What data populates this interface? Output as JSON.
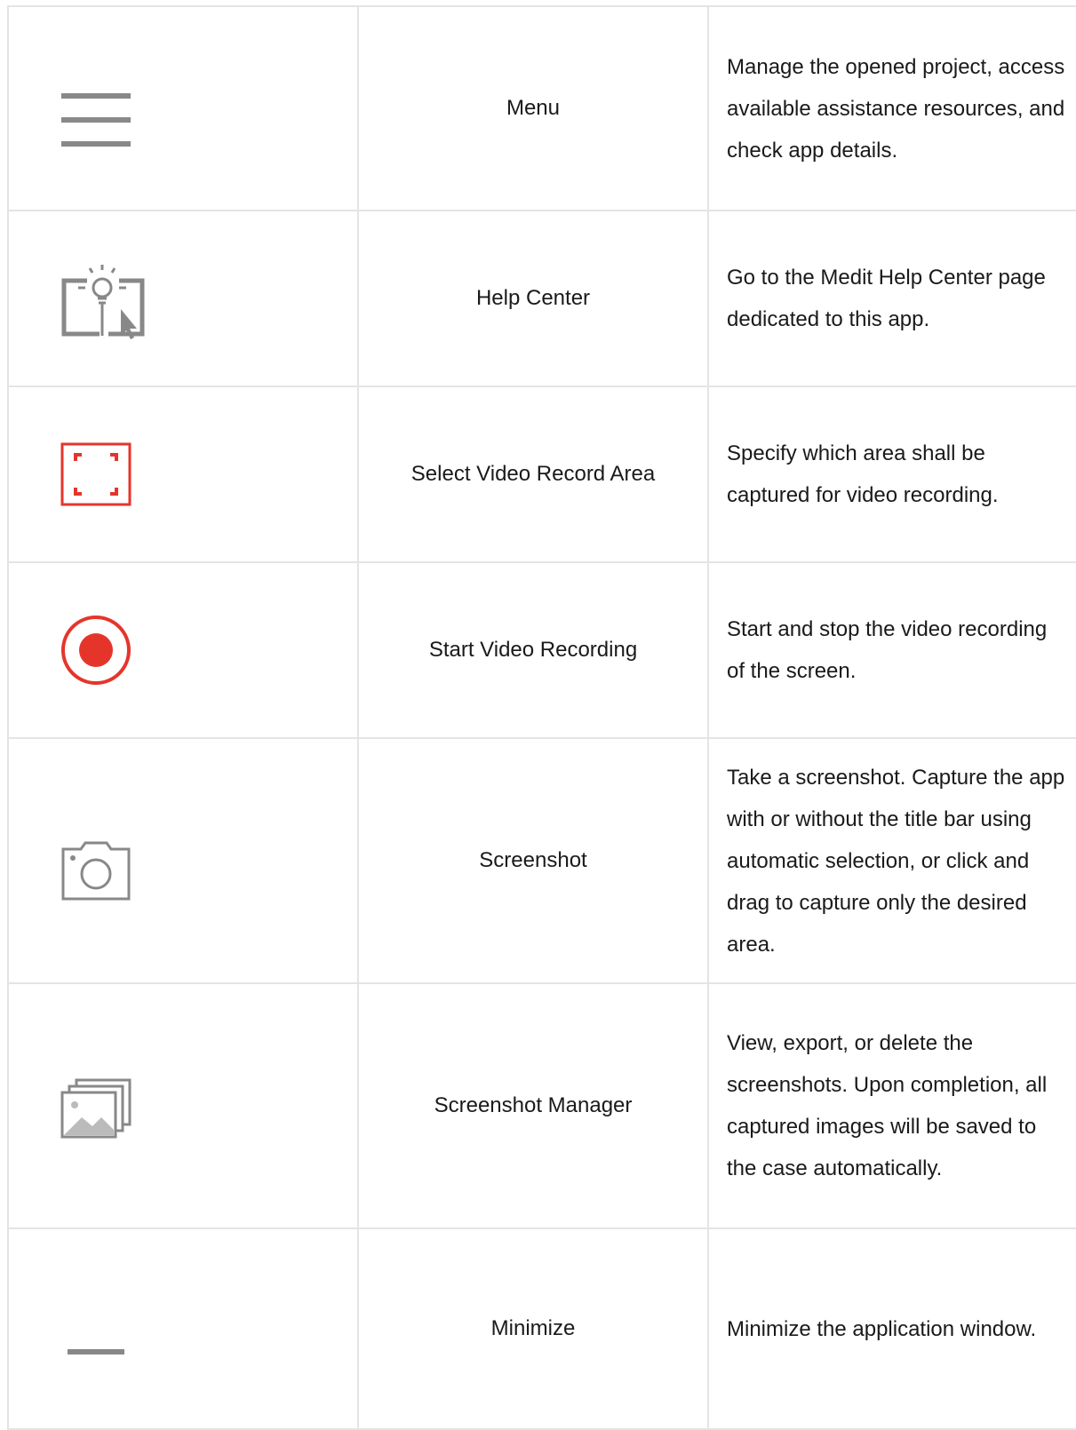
{
  "rows": [
    {
      "icon": "menu-icon",
      "name": "Menu",
      "description": "Manage the opened project, access available assistance resources, and check app details."
    },
    {
      "icon": "help-center-icon",
      "name": "Help Center",
      "description": "Go to the Medit Help Center page dedicated to this app."
    },
    {
      "icon": "select-area-icon",
      "name": "Select Video Record Area",
      "description": "Specify which area shall be captured for video recording."
    },
    {
      "icon": "record-icon",
      "name": "Start Video Recording",
      "description": "Start and stop the video recording of the screen."
    },
    {
      "icon": "camera-icon",
      "name": "Screenshot",
      "description": "Take a screenshot. Capture the app with or without the title bar using automatic selection, or click and drag to capture only the desired area."
    },
    {
      "icon": "screenshot-manager-icon",
      "name": "Screenshot Manager",
      "description": "View, export, or delete the screenshots. Upon completion, all captured images will be saved to the case automatically."
    },
    {
      "icon": "minimize-icon",
      "name": "Minimize",
      "description": "Minimize the application window."
    }
  ],
  "colors": {
    "icon_gray": "#888888",
    "accent_red": "#e5352b",
    "border": "#e4e4e4"
  }
}
